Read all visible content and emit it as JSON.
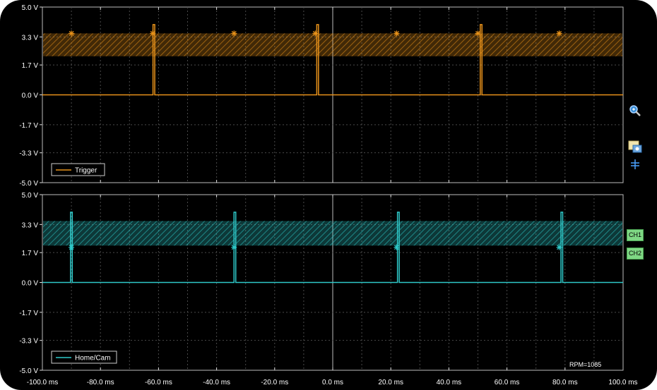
{
  "chart_data": [
    {
      "type": "line",
      "series": [
        {
          "name": "Trigger",
          "color": "#e8921a",
          "pulses_ms": [
            -61.9,
            -5.5,
            50.8
          ],
          "pulse_width_ms": 0.6,
          "high_v": 4.0,
          "low_v": 0.0
        }
      ],
      "band": {
        "from_v": 2.2,
        "to_v": 3.5,
        "color": "#e8921a"
      },
      "markers": {
        "y_v": 3.5,
        "x_ms": [
          -90,
          -62,
          -34,
          -6,
          22,
          50,
          78
        ]
      },
      "y_tick_labels": [
        "5.0 V",
        "3.3 V",
        "1.7 V",
        "0.0 V",
        "-1.7 V",
        "-3.3 V",
        "-5.0 V"
      ],
      "ylim": [
        -5.0,
        5.0
      ],
      "grid": true,
      "legend_position": "bottom-left"
    },
    {
      "type": "line",
      "series": [
        {
          "name": "Home/Cam",
          "color": "#2ec9c9",
          "pulses_ms": [
            -90.3,
            -34.0,
            22.3,
            78.6
          ],
          "pulse_width_ms": 0.6,
          "high_v": 4.0,
          "low_v": 0.0
        }
      ],
      "band": {
        "from_v": 2.1,
        "to_v": 3.5,
        "color": "#2ec9c9"
      },
      "markers": {
        "y_v": 2.0,
        "x_ms": [
          -90,
          -34,
          22,
          78
        ]
      },
      "y_tick_labels": [
        "5.0 V",
        "3.3 V",
        "1.7 V",
        "0.0 V",
        "-1.7 V",
        "-3.3 V",
        "-5.0 V"
      ],
      "ylim": [
        -5.0,
        5.0
      ],
      "grid": true,
      "legend_position": "bottom-left"
    }
  ],
  "x_axis": {
    "tick_labels": [
      "-100.0 ms",
      "-80.0 ms",
      "-60.0 ms",
      "-40.0 ms",
      "-20.0 ms",
      "0.0 ms",
      "20.0 ms",
      "40.0 ms",
      "60.0 ms",
      "80.0 ms",
      "100.0 ms"
    ],
    "xlim": [
      -100,
      100
    ]
  },
  "rpm_readout": "RPM=1085",
  "side_toolbar": {
    "icons": [
      "zoom-icon",
      "snapshot-icon",
      "cursor-icon"
    ],
    "channel_tags": [
      "CH1",
      "CH2"
    ]
  },
  "colors": {
    "background": "#000000",
    "grid": "#555555",
    "axis": "#dddddd"
  }
}
